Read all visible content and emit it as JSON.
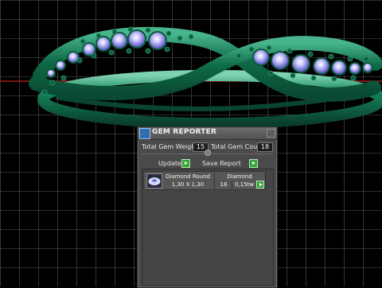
{
  "panel": {
    "title": "GEM REPORTER",
    "total_gem_weight_label": "Total Gem Weight",
    "total_gem_weight_value": "15",
    "total_gem_count_label": "Total Gem Count",
    "total_gem_count_value": "18",
    "update_label": "Update",
    "save_report_label": "Save Report"
  },
  "gem_list": [
    {
      "name": "Diamond Round",
      "size": "1,30 X 1,30",
      "material": "Diamond",
      "count": "18",
      "weight": "0,15tw"
    }
  ],
  "colors": {
    "background": "#000000",
    "grid": "#ffffff",
    "ring": "#0e7a52",
    "gems": "#a9a4ff",
    "axis_red": "#c62020",
    "panel": "#4a4a4a",
    "button_green": "#3aa53a"
  }
}
